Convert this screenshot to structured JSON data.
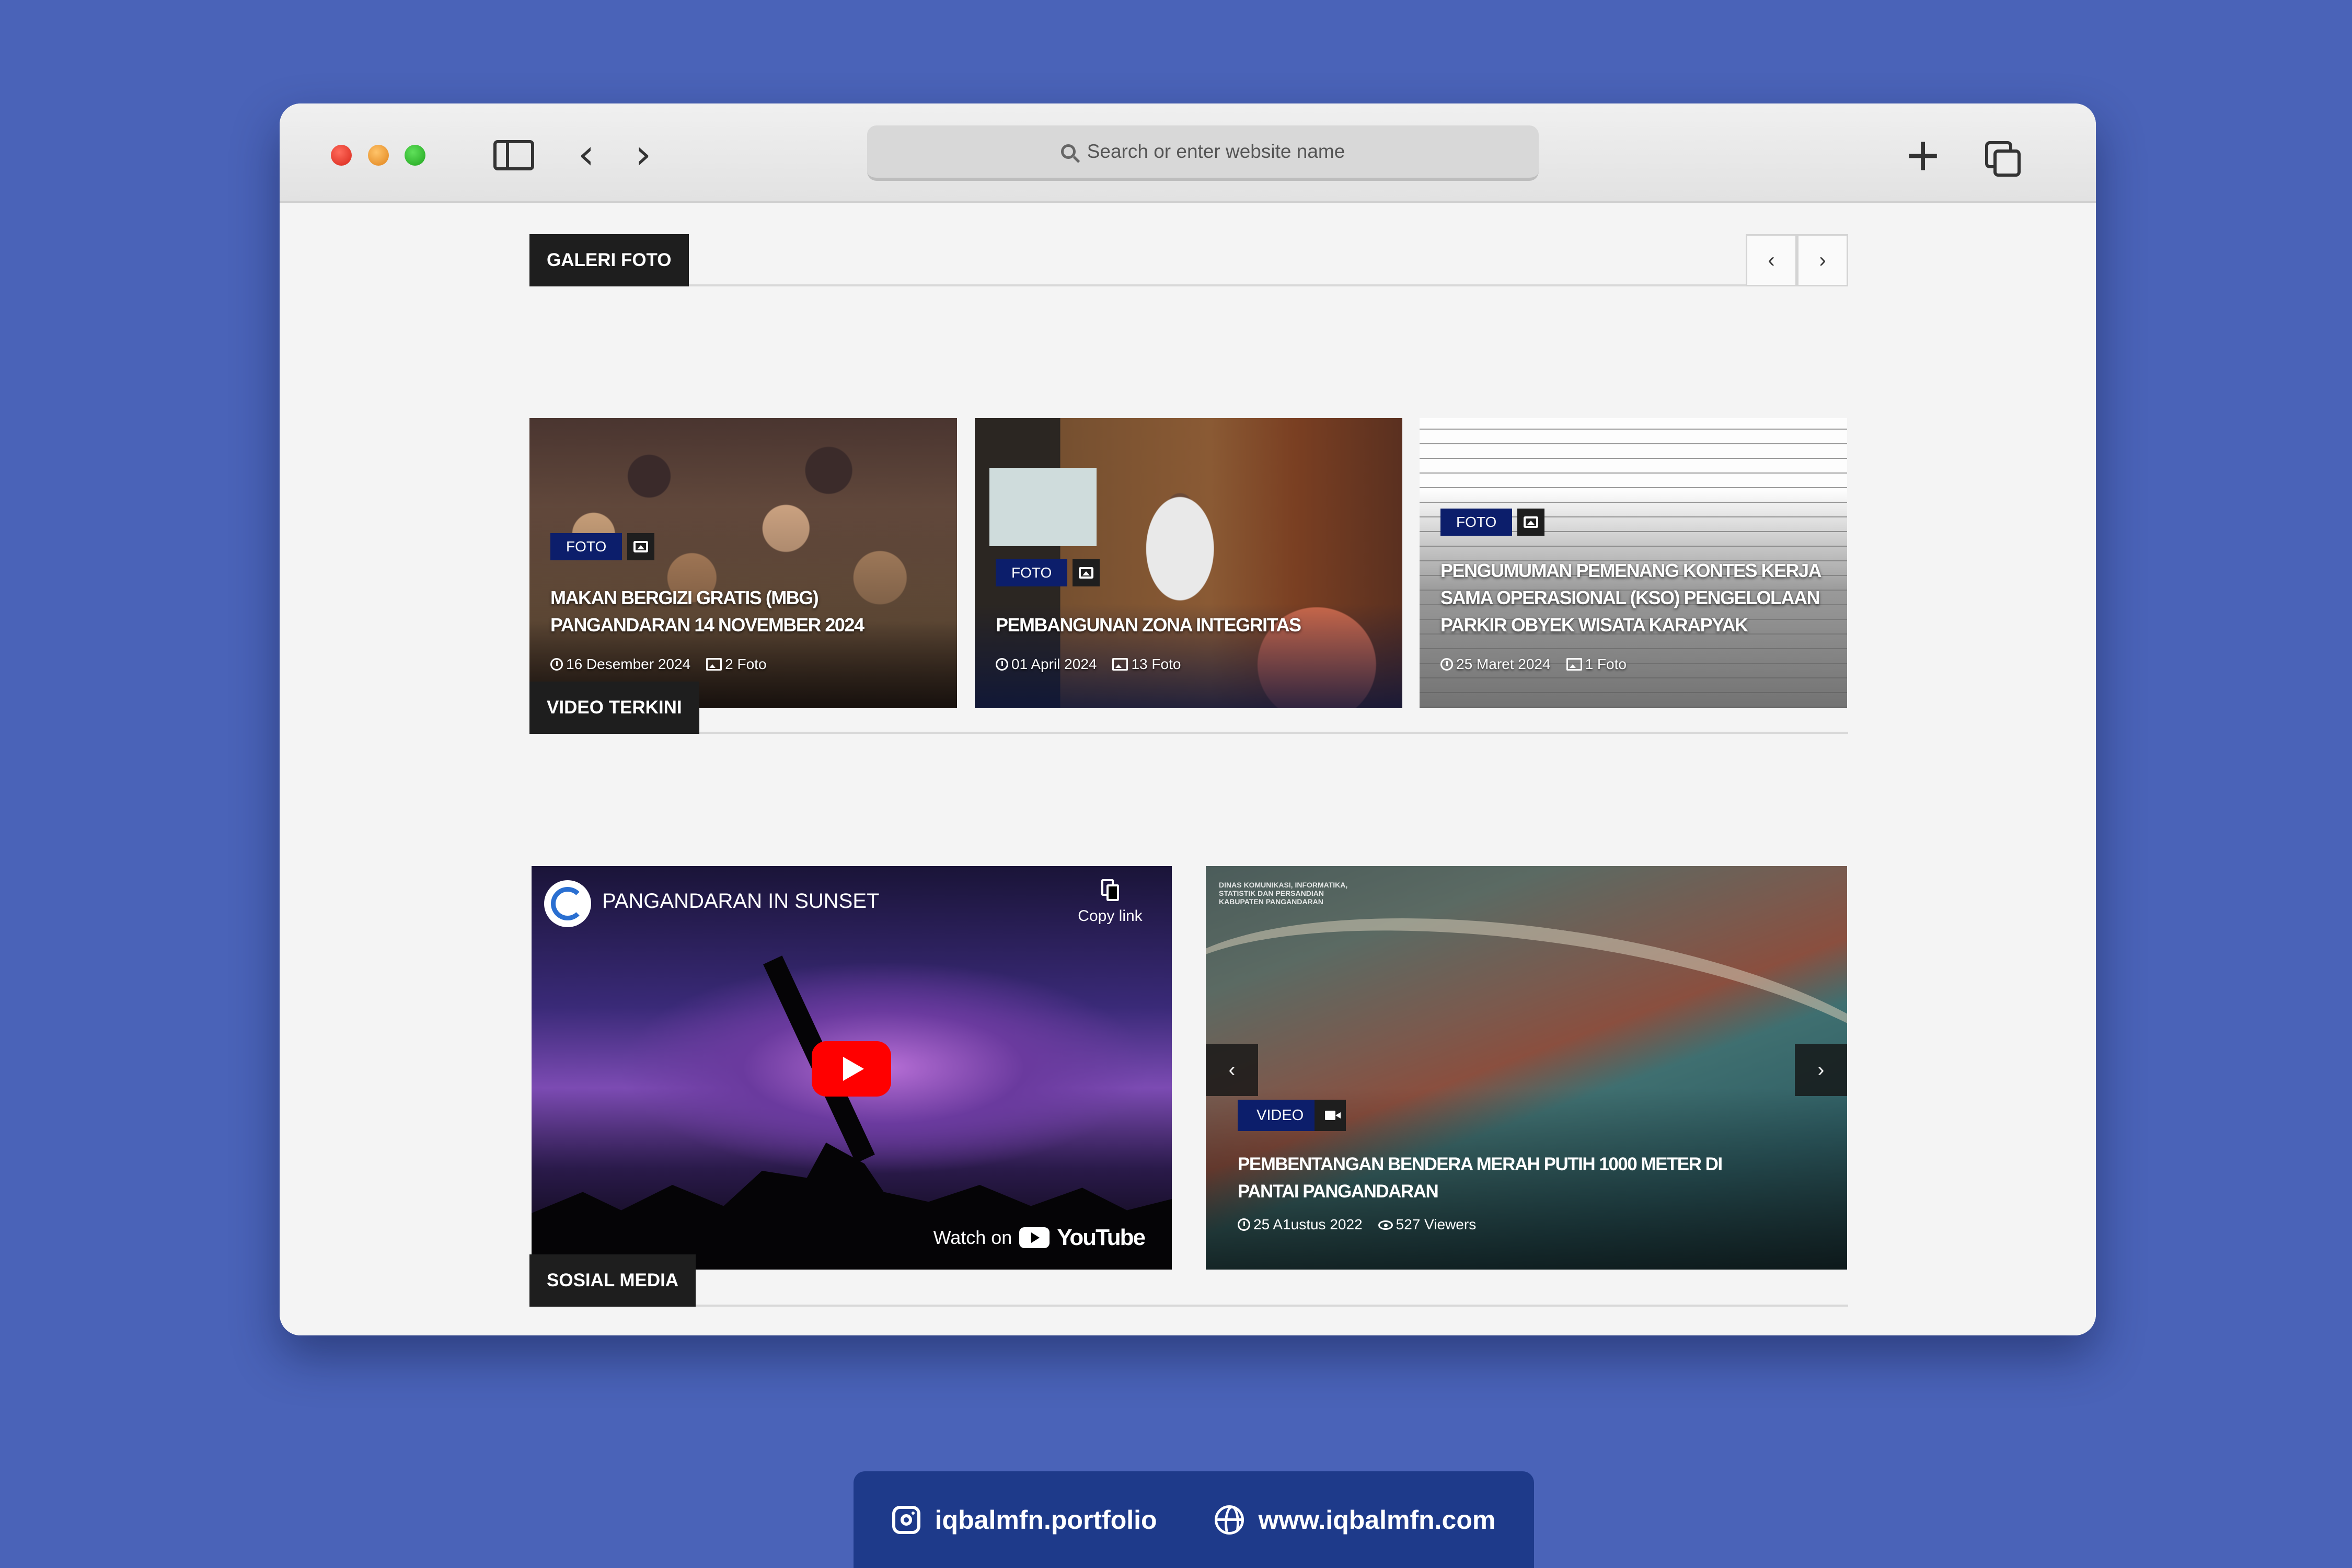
{
  "browser": {
    "url_placeholder": "Search or enter website name"
  },
  "gallery": {
    "heading": "GALERI FOTO",
    "prev_label": "‹",
    "next_label": "›",
    "cards": [
      {
        "category": "FOTO",
        "title": "MAKAN BERGIZI GRATIS (MBG) PANGANDARAN 14 NOVEMBER 2024",
        "date": "16 Desember 2024",
        "photo_count": "2 Foto"
      },
      {
        "category": "FOTO",
        "title": "PEMBANGUNAN ZONA INTEGRITAS",
        "date": "01 April 2024",
        "photo_count": "13 Foto"
      },
      {
        "category": "FOTO",
        "title": "PENGUMUMAN PEMENANG KONTES KERJA SAMA OPERASIONAL (KSO) PENGELOLAAN PARKIR OBYEK WISATA KARAPYAK",
        "date": "25 Maret 2024",
        "photo_count": "1 Foto"
      }
    ]
  },
  "video": {
    "heading": "VIDEO TERKINI",
    "player": {
      "title": "PANGANDARAN IN SUNSET",
      "copy_label": "Copy link",
      "watch_label": "Watch on",
      "platform": "YouTube"
    },
    "featured": {
      "caption_lines": [
        "DINAS KOMUNIKASI, INFORMATIKA,",
        "STATISTIK DAN PERSANDIAN",
        "KABUPATEN PANGANDARAN"
      ],
      "category": "VIDEO",
      "title": "PEMBENTANGAN BENDERA MERAH PUTIH 1000 METER DI PANTAI PANGANDARAN",
      "date": "25 A1ustus 2022",
      "views": "527 Viewers",
      "prev_label": "‹",
      "next_label": "›"
    }
  },
  "social": {
    "heading": "SOSIAL MEDIA"
  },
  "footer": {
    "instagram": "iqbalmfn.portfolio",
    "website": "www.iqbalmfn.com"
  },
  "colors": {
    "background": "#4a63b8",
    "category_badge": "#0c1e6b",
    "section_tab": "#1e1e1e",
    "footer_pill": "#1e3a8a",
    "youtube_red": "#ff0000"
  }
}
